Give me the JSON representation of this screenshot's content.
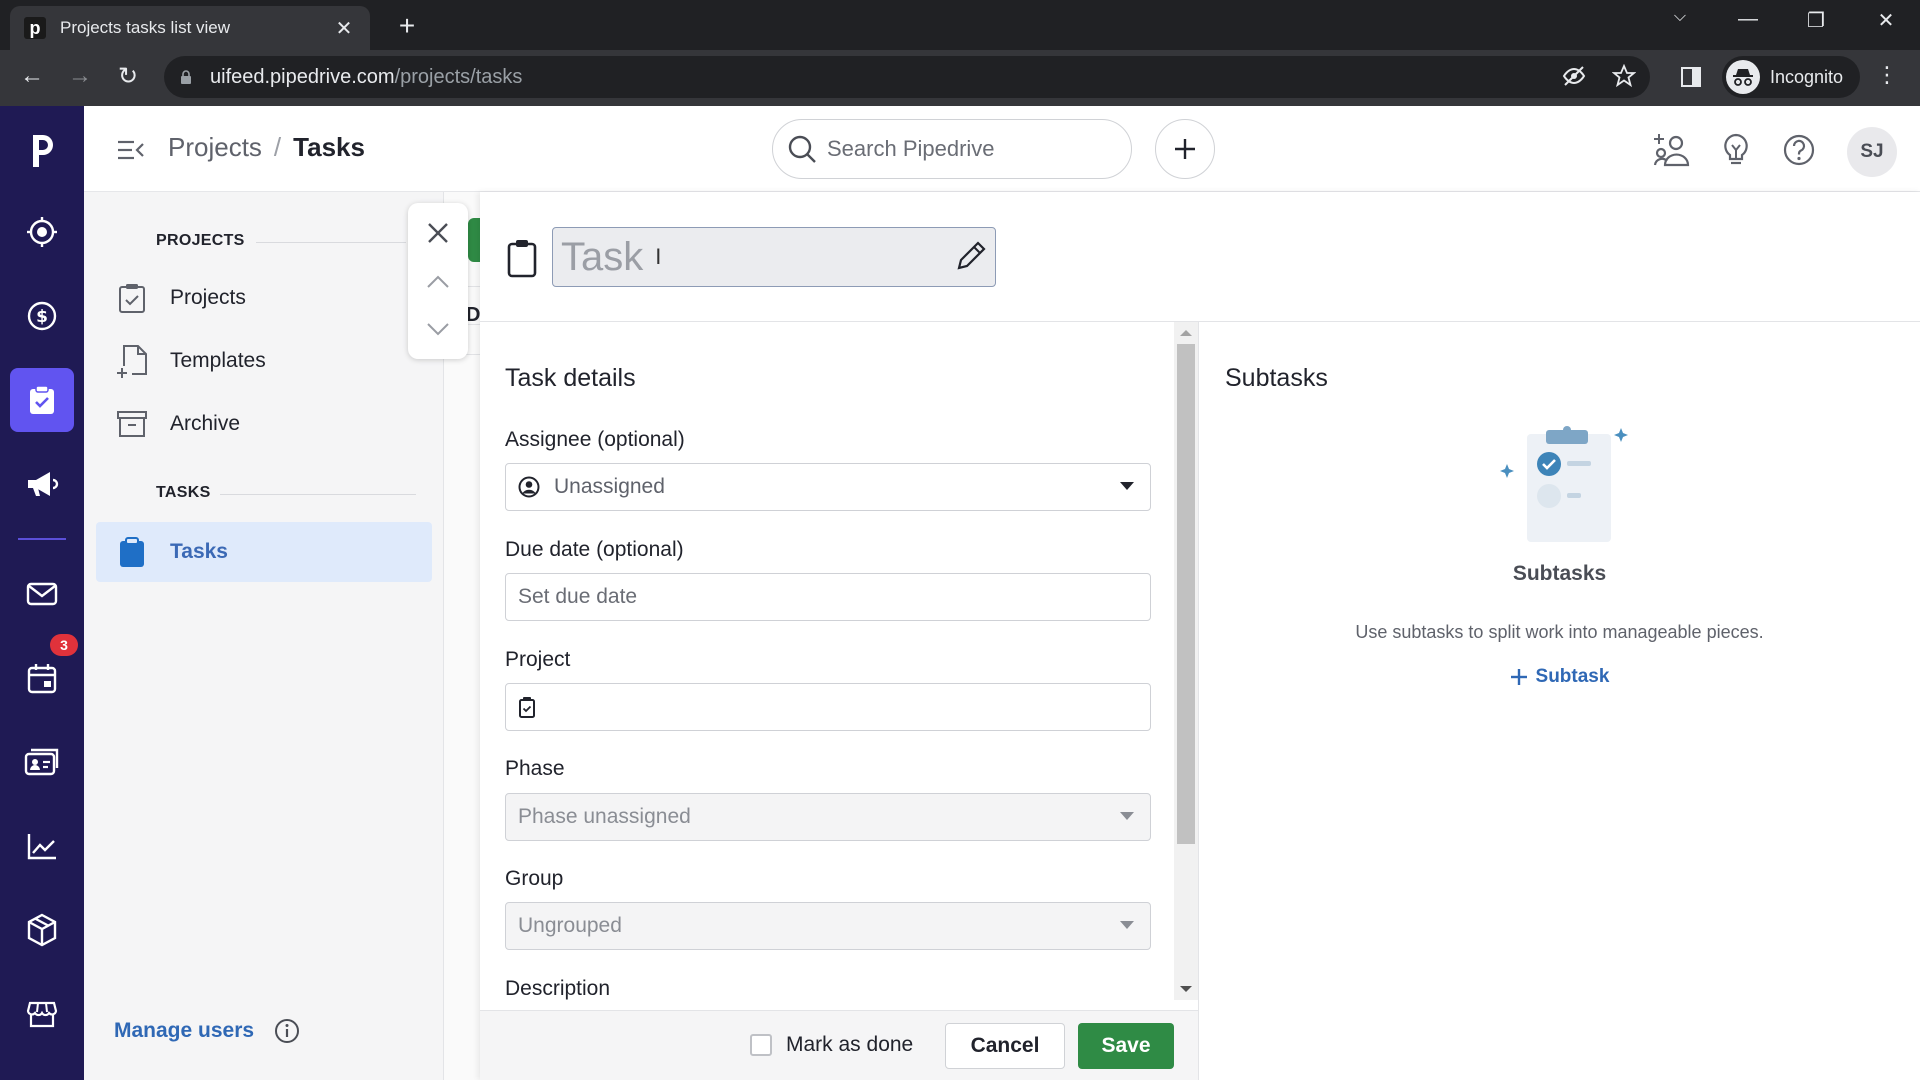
{
  "browser": {
    "tab_title": "Projects tasks list view",
    "favicon_letter": "p",
    "url_host": "uifeed.pipedrive.com",
    "url_path": "/projects/tasks",
    "profile_label": "Incognito"
  },
  "header": {
    "breadcrumb_parent": "Projects",
    "breadcrumb_separator": "/",
    "breadcrumb_current": "Tasks",
    "search_placeholder": "Search Pipedrive",
    "user_initials": "SJ"
  },
  "app_nav": {
    "items": [
      {
        "name": "leads",
        "icon": "target-icon"
      },
      {
        "name": "deals",
        "icon": "dollar-icon"
      },
      {
        "name": "projects",
        "icon": "clipboard-check-icon",
        "active": true
      },
      {
        "name": "campaigns",
        "icon": "megaphone-icon"
      },
      {
        "name": "mail",
        "icon": "mail-icon"
      },
      {
        "name": "activities",
        "icon": "calendar-icon",
        "badge": "3"
      },
      {
        "name": "contacts",
        "icon": "contact-card-icon"
      },
      {
        "name": "insights",
        "icon": "chart-icon"
      },
      {
        "name": "products",
        "icon": "box-icon"
      },
      {
        "name": "marketplace",
        "icon": "store-icon"
      }
    ],
    "activities_badge": "3"
  },
  "sidebar": {
    "projects_section": "PROJECTS",
    "items": [
      {
        "label": "Projects"
      },
      {
        "label": "Templates"
      },
      {
        "label": "Archive"
      }
    ],
    "tasks_section": "TASKS",
    "tasks_item": {
      "label": "Tasks",
      "active": true
    },
    "manage_users": "Manage users"
  },
  "background_list": {
    "column_initial": "D"
  },
  "task_panel": {
    "title_placeholder": "Task",
    "details_heading": "Task details",
    "fields": {
      "assignee_label": "Assignee (optional)",
      "assignee_value": "Unassigned",
      "due_date_label": "Due date (optional)",
      "due_date_placeholder": "Set due date",
      "project_label": "Project",
      "project_value": "",
      "phase_label": "Phase",
      "phase_value": "Phase unassigned",
      "group_label": "Group",
      "group_value": "Ungrouped",
      "description_label": "Description"
    },
    "footer": {
      "mark_done_label": "Mark as done",
      "mark_done_checked": false,
      "cancel_label": "Cancel",
      "save_label": "Save"
    },
    "subtasks": {
      "heading": "Subtasks",
      "empty_title": "Subtasks",
      "empty_description": "Use subtasks to split work into manageable pieces.",
      "add_label": "Subtask"
    }
  },
  "colors": {
    "nav_bg": "#1f1a54",
    "nav_active": "#6154f0",
    "save_green": "#2f8b45",
    "link_blue": "#2f68b5",
    "badge_red": "#e0323b"
  }
}
